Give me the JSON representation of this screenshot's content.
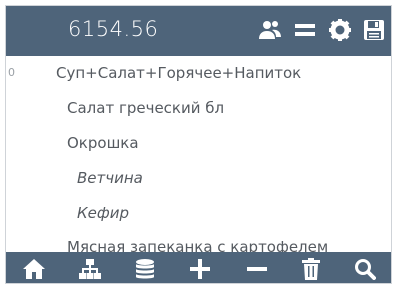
{
  "header": {
    "total": "6154.56",
    "icons": [
      "users-icon",
      "menu-equals-icon",
      "settings-icon",
      "save-icon"
    ]
  },
  "order": {
    "items": [
      {
        "qty": "0",
        "text": "Суп+Салат+Горячее+Напиток",
        "kind": "combo"
      },
      {
        "qty": "",
        "text": "Салат греческий бл",
        "kind": "dish"
      },
      {
        "qty": "",
        "text": "Окрошка",
        "kind": "dish"
      },
      {
        "qty": "",
        "text": "Ветчина",
        "kind": "ingredient"
      },
      {
        "qty": "",
        "text": "Кефир",
        "kind": "ingredient"
      },
      {
        "qty": "",
        "text": "Мясная запеканка с картофелем",
        "kind": "dish"
      }
    ]
  },
  "toolbar": {
    "icons": [
      "home-icon",
      "hierarchy-icon",
      "database-icon",
      "plus-icon",
      "minus-icon",
      "trash-icon",
      "search-icon"
    ]
  },
  "colors": {
    "bar": "#4e647a",
    "text": "#555a60"
  }
}
